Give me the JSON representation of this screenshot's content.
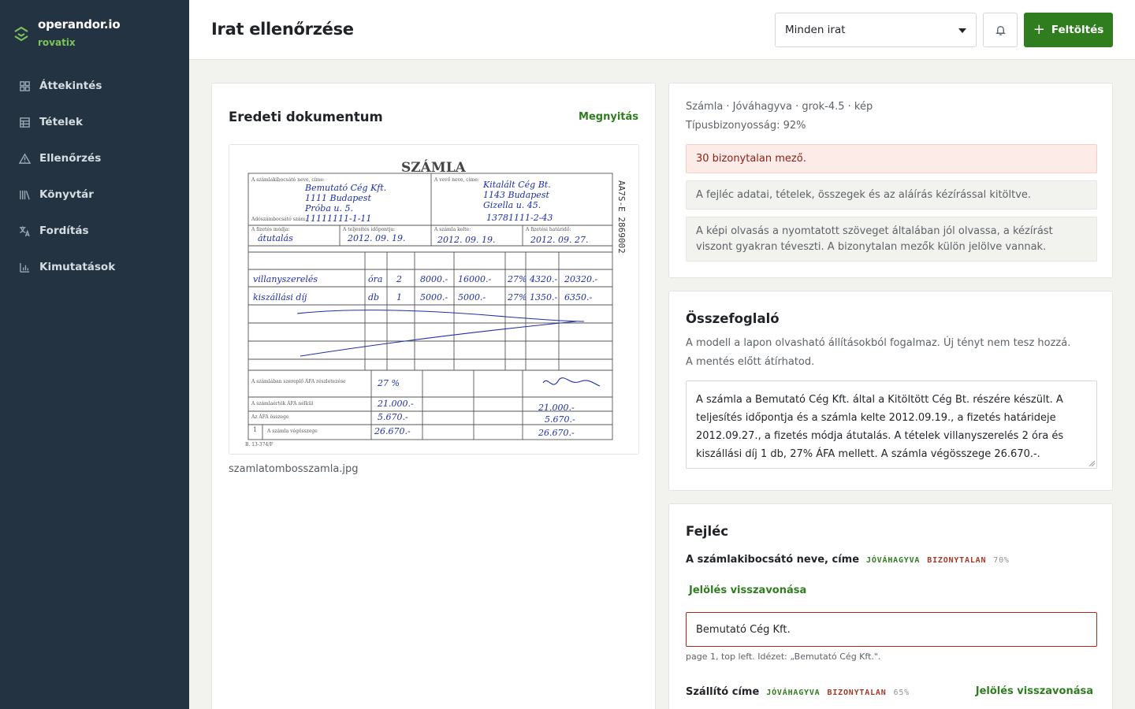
{
  "brand": {
    "name": "operandor.io",
    "workspace": "rovatix"
  },
  "sidebar": {
    "items": [
      {
        "label": "Áttekintés",
        "icon": "grid-icon"
      },
      {
        "label": "Tételek",
        "icon": "table-icon"
      },
      {
        "label": "Ellenőrzés",
        "icon": "warning-icon"
      },
      {
        "label": "Könyvtár",
        "icon": "library-icon"
      },
      {
        "label": "Fordítás",
        "icon": "translate-icon"
      },
      {
        "label": "Kimutatások",
        "icon": "bar-chart-icon"
      }
    ]
  },
  "header": {
    "title": "Irat ellenőrzése",
    "filter_value": "Minden irat",
    "upload_label": "Feltöltés"
  },
  "document": {
    "title": "Eredeti dokumentum",
    "open_label": "Megnyitás",
    "filename": "szamlatombosszamla.jpg",
    "invoice_image": {
      "title": "SZÁMLA",
      "serial": "AA7S-E 2869002",
      "issuer_label": "A számlakibocsátó neve, címe:",
      "issuer_lines": [
        "Bemutató Cég Kft.",
        "1111 Budapest",
        "Próba u. 5."
      ],
      "issuer_taxid_label": "Adószámbocsátó szám:",
      "issuer_taxid": "11111111-1-11",
      "customer_label": "A vevő neve, címe:",
      "customer_lines": [
        "Kitalált Cég Bt.",
        "1143 Budapest",
        "Gizella u. 45."
      ],
      "customer_taxid": "13781111-2-43",
      "payment_method_label": "A fizetés módja:",
      "payment_method": "átutalás",
      "completion_label": "A teljesítés időpontja:",
      "completion_date": "2012. 09. 19.",
      "issue_label": "A számla kelte:",
      "issue_date": "2012. 09. 19.",
      "due_label": "A fizetési határidő:",
      "due_date": "2012. 09. 27.",
      "rows": [
        {
          "item": "villanyszerelés",
          "unit": "óra",
          "qty": "2",
          "unit_price": "8000.-",
          "net": "16000.-",
          "vat": "27%",
          "vat_amount": "4320.-",
          "gross": "20320.-"
        },
        {
          "item": "kiszállási díj",
          "unit": "db",
          "qty": "1",
          "unit_price": "5000.-",
          "net": "5000.-",
          "vat": "27%",
          "vat_amount": "1350.-",
          "gross": "6350.-"
        }
      ],
      "vat_rate_row_label": "A számlában szereplő ÁFA részletezése",
      "vat_rate": "27 %",
      "net_total_label": "A számlaérték ÁFA nélkül",
      "net_total": "21.000.-",
      "vat_total_label": "Az ÁFA összege",
      "vat_total": "5.670.-",
      "grand_total_label": "A számla végösszege",
      "grand_total": "26.670.-",
      "footer_code": "B. 13-374/F"
    }
  },
  "meta": {
    "line1": "Számla · Jóváhagyva · grok-4.5 · kép",
    "line2": "Típusbizonyosság: 92%",
    "alert": "30 bizonytalan mező.",
    "info1": "A fejléc adatai, tételek, összegek és az aláírás kézírással kitöltve.",
    "info2": "A képi olvasás a nyomtatott szöveget általában jól olvassa, a kézírást viszont gyakran téveszti. A bizonytalan mezők külön jelölve vannak."
  },
  "summary": {
    "title": "Összefoglaló",
    "description": "A modell a lapon olvasható állításokból fogalmaz. Új tényt nem tesz hozzá. A mentés előtt átírhatod.",
    "text": "A számla a Bemutató Cég Kft. által a Kitöltött Cég Bt. részére készült. A teljesítés időpontja és a számla kelte 2012.09.19., a fizetés határideje 2012.09.27., a fizetés módja átutalás. A tételek villanyszerelés 2 óra és kiszállási díj 1 db, 27% ÁFA mellett. A számla végösszege 26.670.-."
  },
  "fields_section": {
    "title": "Fejléc",
    "fields": [
      {
        "label": "A számlakibocsátó neve, címe",
        "status": "JÓVÁHAGYVA",
        "flag": "BIZONYTALAN",
        "confidence": "70%",
        "revoke_label": "Jelölés visszavonása",
        "value": "Bemutató Cég Kft.",
        "source": "page 1, top left. Idézet: „Bemutató Cég Kft.\"."
      },
      {
        "label": "Szállító címe",
        "status": "JÓVÁHAGYVA",
        "flag": "BIZONYTALAN",
        "confidence": "65%",
        "revoke_label": "Jelölés visszavonása"
      }
    ]
  },
  "colors": {
    "sidebar_bg": "#233341",
    "accent_green": "#2f7d1f",
    "brand_green": "#7cc35a",
    "alert_bg": "#fcebe7",
    "alert_text": "#8a1e14",
    "ink_blue": "#1d2fa8"
  }
}
